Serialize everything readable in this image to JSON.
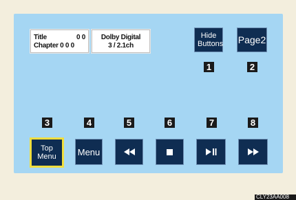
{
  "info": {
    "title_label": "Title",
    "title_value": "0 0",
    "chapter_label": "Chapter 0 0 0",
    "audio_line1": "Dolby Digital",
    "audio_line2": "3 / 2.1ch"
  },
  "buttons": {
    "hide_buttons": "Hide Buttons",
    "page2": "Page2",
    "top_menu": "Top Menu",
    "menu": "Menu"
  },
  "icons": {
    "rewind": "rewind-icon",
    "stop": "stop-icon",
    "play_pause": "play-pause-icon",
    "fast_forward": "fast-forward-icon"
  },
  "callouts": [
    "1",
    "2",
    "3",
    "4",
    "5",
    "6",
    "7",
    "8"
  ],
  "reference_code": "CLY23AA008",
  "colors": {
    "screen_bg": "#a5d6f3",
    "button_bg": "#0f2d52",
    "selected_outline": "#f0de3f",
    "callout_bg": "#1a1a1a"
  }
}
